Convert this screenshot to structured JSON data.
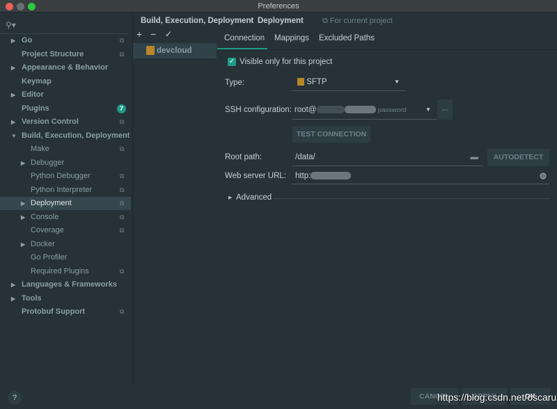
{
  "window": {
    "title": "Preferences"
  },
  "sidebar": {
    "search_icon": "search-icon",
    "items": [
      {
        "label": "Go",
        "arrow": true,
        "copy": true,
        "indent": 0
      },
      {
        "label": "Project Structure",
        "arrow": false,
        "copy": true,
        "indent": 0
      },
      {
        "label": "Appearance & Behavior",
        "arrow": true,
        "copy": false,
        "indent": 0
      },
      {
        "label": "Keymap",
        "arrow": false,
        "copy": false,
        "indent": 0
      },
      {
        "label": "Editor",
        "arrow": true,
        "copy": false,
        "indent": 0
      },
      {
        "label": "Plugins",
        "arrow": false,
        "copy": false,
        "indent": 0,
        "badge": "7"
      },
      {
        "label": "Version Control",
        "arrow": true,
        "copy": true,
        "indent": 0
      },
      {
        "label": "Build, Execution, Deployment",
        "arrow": "open",
        "copy": false,
        "indent": 0
      },
      {
        "label": "Make",
        "arrow": false,
        "copy": true,
        "indent": 1
      },
      {
        "label": "Debugger",
        "arrow": true,
        "copy": false,
        "indent": 1
      },
      {
        "label": "Python Debugger",
        "arrow": false,
        "copy": true,
        "indent": 1
      },
      {
        "label": "Python Interpreter",
        "arrow": false,
        "copy": true,
        "indent": 1
      },
      {
        "label": "Deployment",
        "arrow": true,
        "copy": true,
        "indent": 1,
        "selected": true
      },
      {
        "label": "Console",
        "arrow": true,
        "copy": true,
        "indent": 1
      },
      {
        "label": "Coverage",
        "arrow": false,
        "copy": true,
        "indent": 1
      },
      {
        "label": "Docker",
        "arrow": true,
        "copy": false,
        "indent": 1
      },
      {
        "label": "Go Profiler",
        "arrow": false,
        "copy": false,
        "indent": 1
      },
      {
        "label": "Required Plugins",
        "arrow": false,
        "copy": true,
        "indent": 1
      },
      {
        "label": "Languages & Frameworks",
        "arrow": true,
        "copy": false,
        "indent": 0
      },
      {
        "label": "Tools",
        "arrow": true,
        "copy": false,
        "indent": 0
      },
      {
        "label": "Protobuf Support",
        "arrow": false,
        "copy": true,
        "indent": 0
      }
    ]
  },
  "breadcrumb": {
    "parent": "Build, Execution, Deployment",
    "sep": "›",
    "current": "Deployment",
    "scope": "For current project"
  },
  "servers": {
    "add": "+",
    "remove": "−",
    "default": "✓",
    "items": [
      {
        "name": "devcloud"
      }
    ]
  },
  "tabs": [
    {
      "label": "Connection",
      "active": true
    },
    {
      "label": "Mappings"
    },
    {
      "label": "Excluded Paths"
    }
  ],
  "connection": {
    "visible_only": {
      "label": "Visible only for this project",
      "checked": true
    },
    "type": {
      "label": "Type:",
      "value": "SFTP"
    },
    "ssh": {
      "label": "SSH configuration:",
      "value": "root@",
      "suffix": "password",
      "more": "..."
    },
    "test_button": "TEST CONNECTION",
    "root_path": {
      "label": "Root path:",
      "value": "/data/"
    },
    "autodetect": "AUTODETECT",
    "web_url": {
      "label": "Web server URL:",
      "value": "http:"
    },
    "advanced": "Advanced"
  },
  "footer": {
    "help": "?",
    "cancel": "CANCEL",
    "apply": "APPLY",
    "ok": "OK"
  },
  "watermark": "https://blog.csdn.net/oscarun",
  "colors": {
    "accent": "#1e9b86",
    "background": "#263238",
    "selection": "#37474f"
  }
}
